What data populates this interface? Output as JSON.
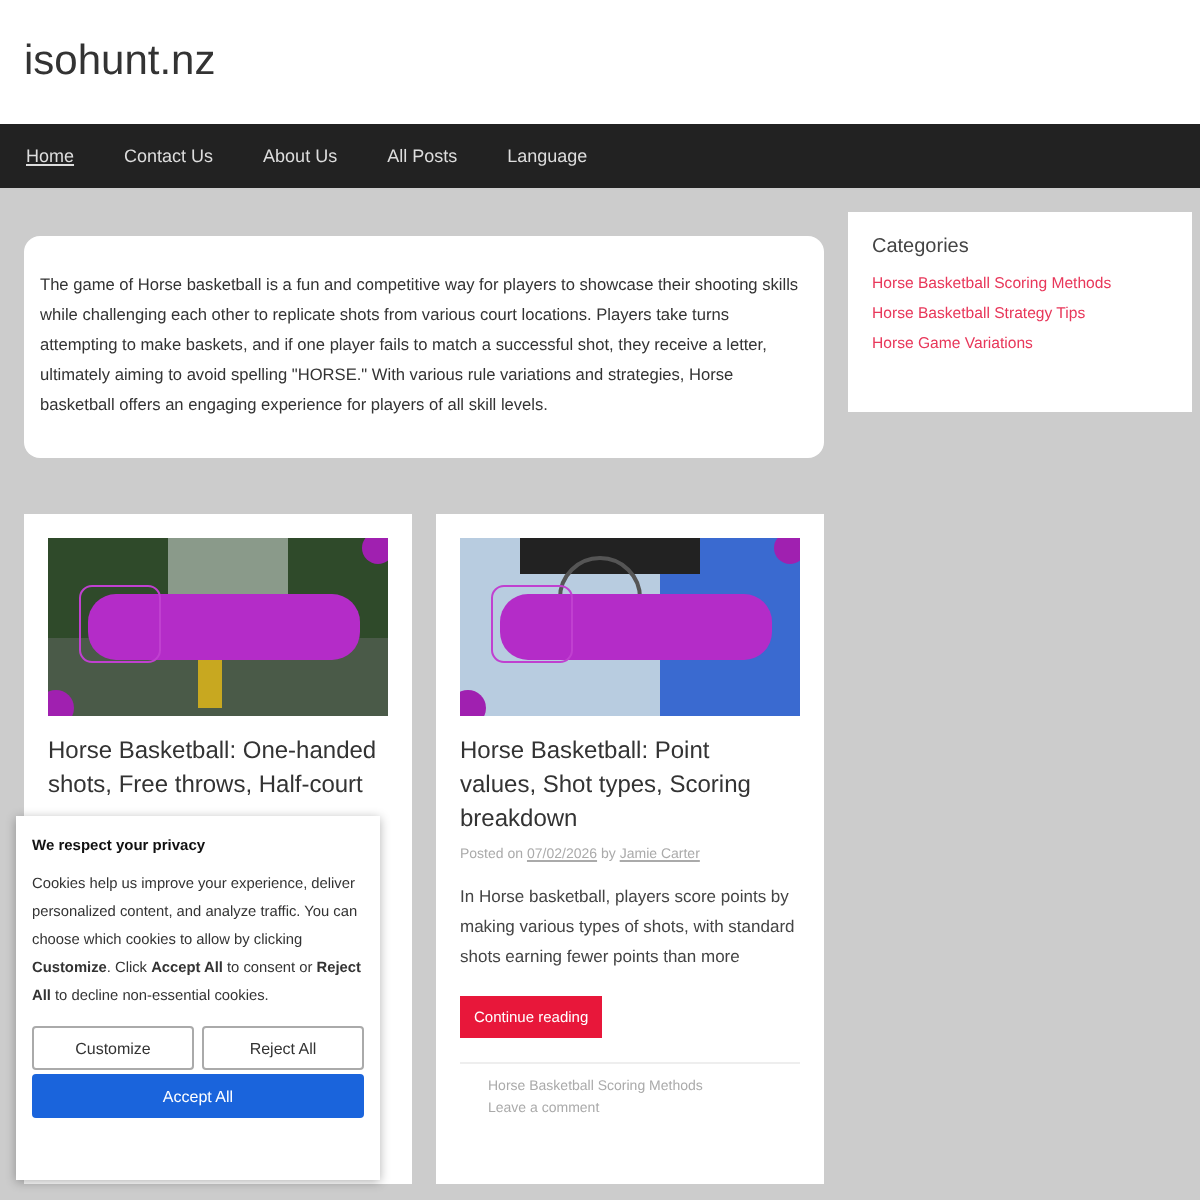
{
  "site_title": "isohunt.nz",
  "nav": [
    {
      "label": "Home",
      "selected": true
    },
    {
      "label": "Contact Us",
      "selected": false
    },
    {
      "label": "About Us",
      "selected": false
    },
    {
      "label": "All Posts",
      "selected": false
    },
    {
      "label": "Language",
      "selected": false
    }
  ],
  "intro": "The game of Horse basketball is a fun and competitive way for players to showcase their shooting skills while challenging each other to replicate shots from various court locations. Players take turns attempting to make baskets, and if one player fails to match a successful shot, they receive a letter, ultimately aiming to avoid spelling \"HORSE.\" With various rule variations and strategies, Horse basketball offers an engaging experience for players of all skill levels.",
  "posts": [
    {
      "kind": "court",
      "title": "Horse Basketball: One-handed shots, Free throws, Half-court"
    },
    {
      "kind": "hoop",
      "title": "Horse Basketball: Point values, Shot types, Scoring breakdown",
      "posted_prefix": "Posted on",
      "date": "07/02/2026",
      "by": "by",
      "author": "Jamie Carter",
      "excerpt": "In Horse basketball, players score points by making various types of shots, with standard shots earning fewer points than more",
      "button": "Continue reading",
      "category": "Horse Basketball Scoring Methods",
      "comment": "Leave a comment"
    }
  ],
  "sidebar": {
    "title": "Categories",
    "items": [
      "Horse Basketball Scoring Methods",
      "Horse Basketball Strategy Tips",
      "Horse Game Variations"
    ]
  },
  "cookie": {
    "title": "We respect your privacy",
    "text": "Cookies help us improve your experience, deliver personalized content, and analyze traffic. You can choose which cookies to allow by clicking **Customize**. Click **Accept All** to consent or **Reject All** to decline non-essential cookies.",
    "buttons": [
      "Customize",
      "Reject All"
    ],
    "accept": "Accept All"
  }
}
